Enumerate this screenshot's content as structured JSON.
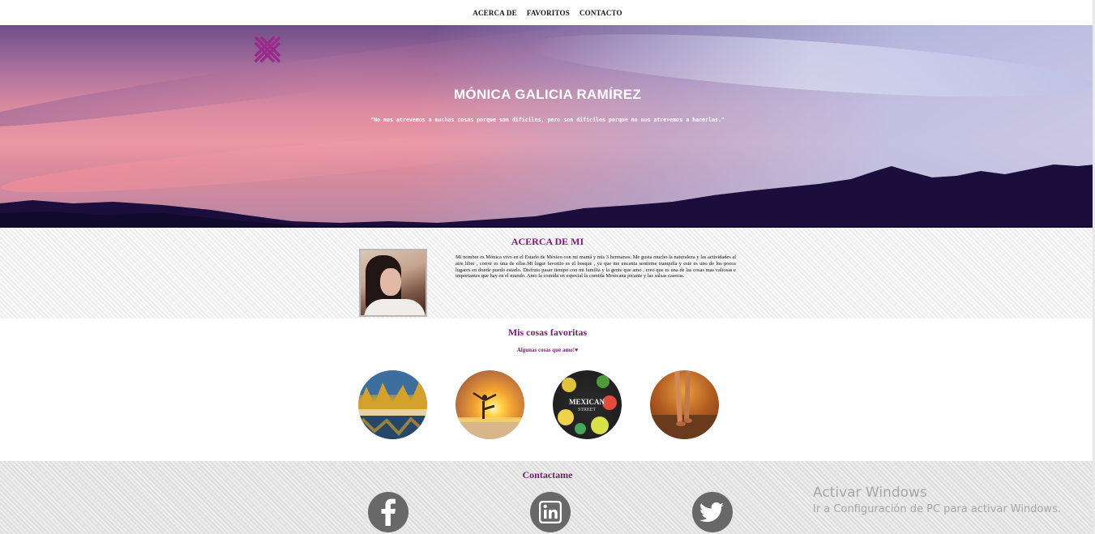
{
  "nav": {
    "items": [
      "ACERCA DE",
      "FAVORITOS",
      "CONTACTO"
    ]
  },
  "hero": {
    "title": "MÓNICA GALICIA RAMÍREZ",
    "quote": "\"No nos atrevemos a muchas cosas porque son difíciles, pero son difíciles porque no nos atrevemos a hacerlas.\"",
    "logo_color": "#9b2a8e"
  },
  "about": {
    "heading": "ACERCA DE MI",
    "bio": "Mi nombre es Mónica vivo en el Estado de México con mi mamá y mis 3 hermanos. Me gusta mucho la naturaleza y las actividades al aire libre , correr es una de ellas.Mi lugar favorito es el bosque , ya que me encanta sentirme tranquila y este es uno de los pocos lugares en donde puedo estarlo. Disfruto pasar tiempo con mi familia y la gente que amo , creo que es una de las cosas mas valiosas e importantes que hay en el mundo. Amo la comida en especial la comida Mexicana picante y las salsas caseras."
  },
  "favorites": {
    "heading": "Mis cosas favoritas",
    "subheading": "Algunas cosas que amo!♥",
    "items": [
      "forest-lake-image",
      "sunset-yoga-image",
      "mexican-food-image",
      "barefoot-path-image"
    ]
  },
  "contact": {
    "heading": "Contactame",
    "icons": [
      "facebook-icon",
      "linkedin-icon",
      "twitter-icon"
    ]
  },
  "watermark": {
    "line1": "Activar Windows",
    "line2": "Ir a Configuración de PC para activar Windows."
  },
  "colors": {
    "accent": "#7a1a78",
    "icon_gray": "#686868"
  }
}
